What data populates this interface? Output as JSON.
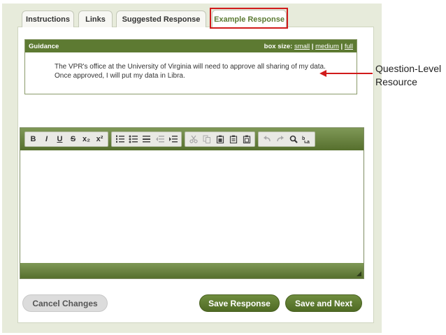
{
  "tabs": [
    {
      "label": "Instructions"
    },
    {
      "label": "Links"
    },
    {
      "label": "Suggested Response"
    },
    {
      "label": "Example Response"
    }
  ],
  "guidance": {
    "title": "Guidance",
    "box_size_label": "box size:",
    "sizes": [
      "small",
      "medium",
      "full"
    ],
    "separator": "|",
    "text": "The VPR's office at the University of Virginia will need to approve all sharing of my data. Once approved, I will put my data in Libra."
  },
  "toolbar": {
    "bold": "B",
    "italic": "I",
    "underline": "U",
    "strike": "S",
    "subscript": "x₂",
    "superscript": "x²"
  },
  "buttons": {
    "cancel": "Cancel Changes",
    "save": "Save Response",
    "save_next": "Save and Next"
  },
  "annotation": {
    "line1": "Question-Level",
    "line2": "Resource"
  },
  "colors": {
    "accent_green": "#5d7a32",
    "highlight_red": "#d11b1b"
  }
}
